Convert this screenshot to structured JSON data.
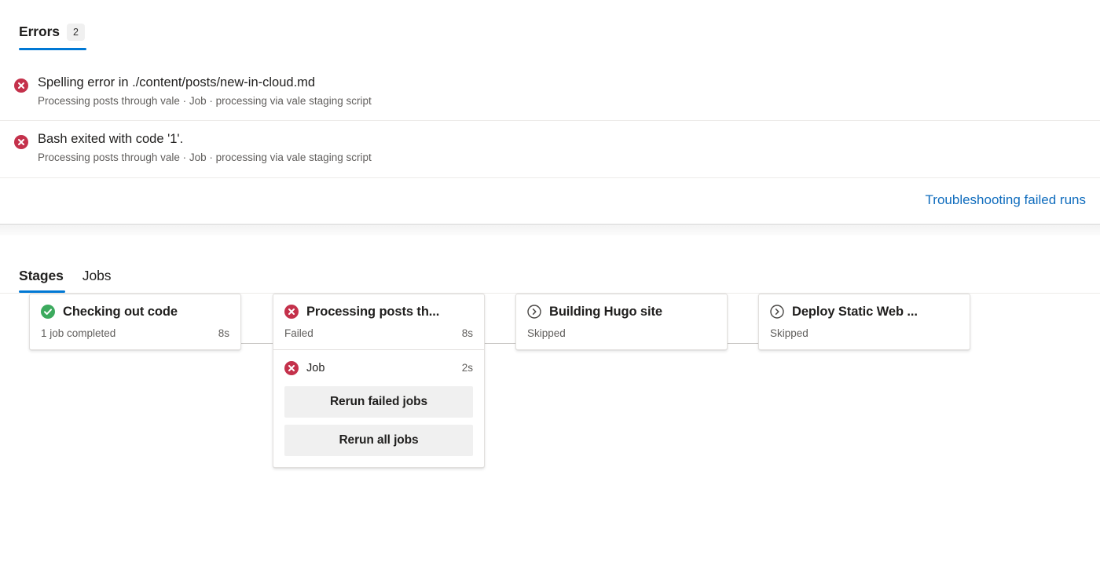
{
  "errors_panel": {
    "tab_label": "Errors",
    "count": "2",
    "accent_color": "#0078d4",
    "error_color": "#c4314b",
    "items": [
      {
        "icon": "error-circle-icon",
        "title": "Spelling error in ./content/posts/new-in-cloud.md",
        "subtitle": "Processing posts through vale · Job · processing via vale staging script"
      },
      {
        "icon": "error-circle-icon",
        "title": "Bash exited with code '1'.",
        "subtitle": "Processing posts through vale · Job · processing via vale staging script"
      }
    ],
    "troubleshoot_link": "Troubleshooting failed runs",
    "link_color": "#0f6cbd"
  },
  "stages_panel": {
    "tabs": [
      {
        "label": "Stages",
        "active": true
      },
      {
        "label": "Jobs",
        "active": false
      }
    ],
    "stages": [
      {
        "icon": "success-check-icon",
        "title": "Checking out code",
        "status": "1 job completed",
        "duration": "8s"
      },
      {
        "icon": "error-circle-icon",
        "title": "Processing posts th...",
        "status": "Failed",
        "duration": "8s",
        "jobs": [
          {
            "icon": "error-circle-icon",
            "name": "Job",
            "duration": "2s"
          }
        ],
        "buttons": [
          {
            "label": "Rerun failed jobs"
          },
          {
            "label": "Rerun all jobs"
          }
        ]
      },
      {
        "icon": "skipped-chevron-icon",
        "title": "Building Hugo site",
        "status": "Skipped",
        "duration": ""
      },
      {
        "icon": "skipped-chevron-icon",
        "title": "Deploy Static Web ...",
        "status": "Skipped",
        "duration": ""
      }
    ],
    "colors": {
      "success": "#107c41",
      "error": "#c4314b",
      "skipped": "#484644"
    }
  }
}
